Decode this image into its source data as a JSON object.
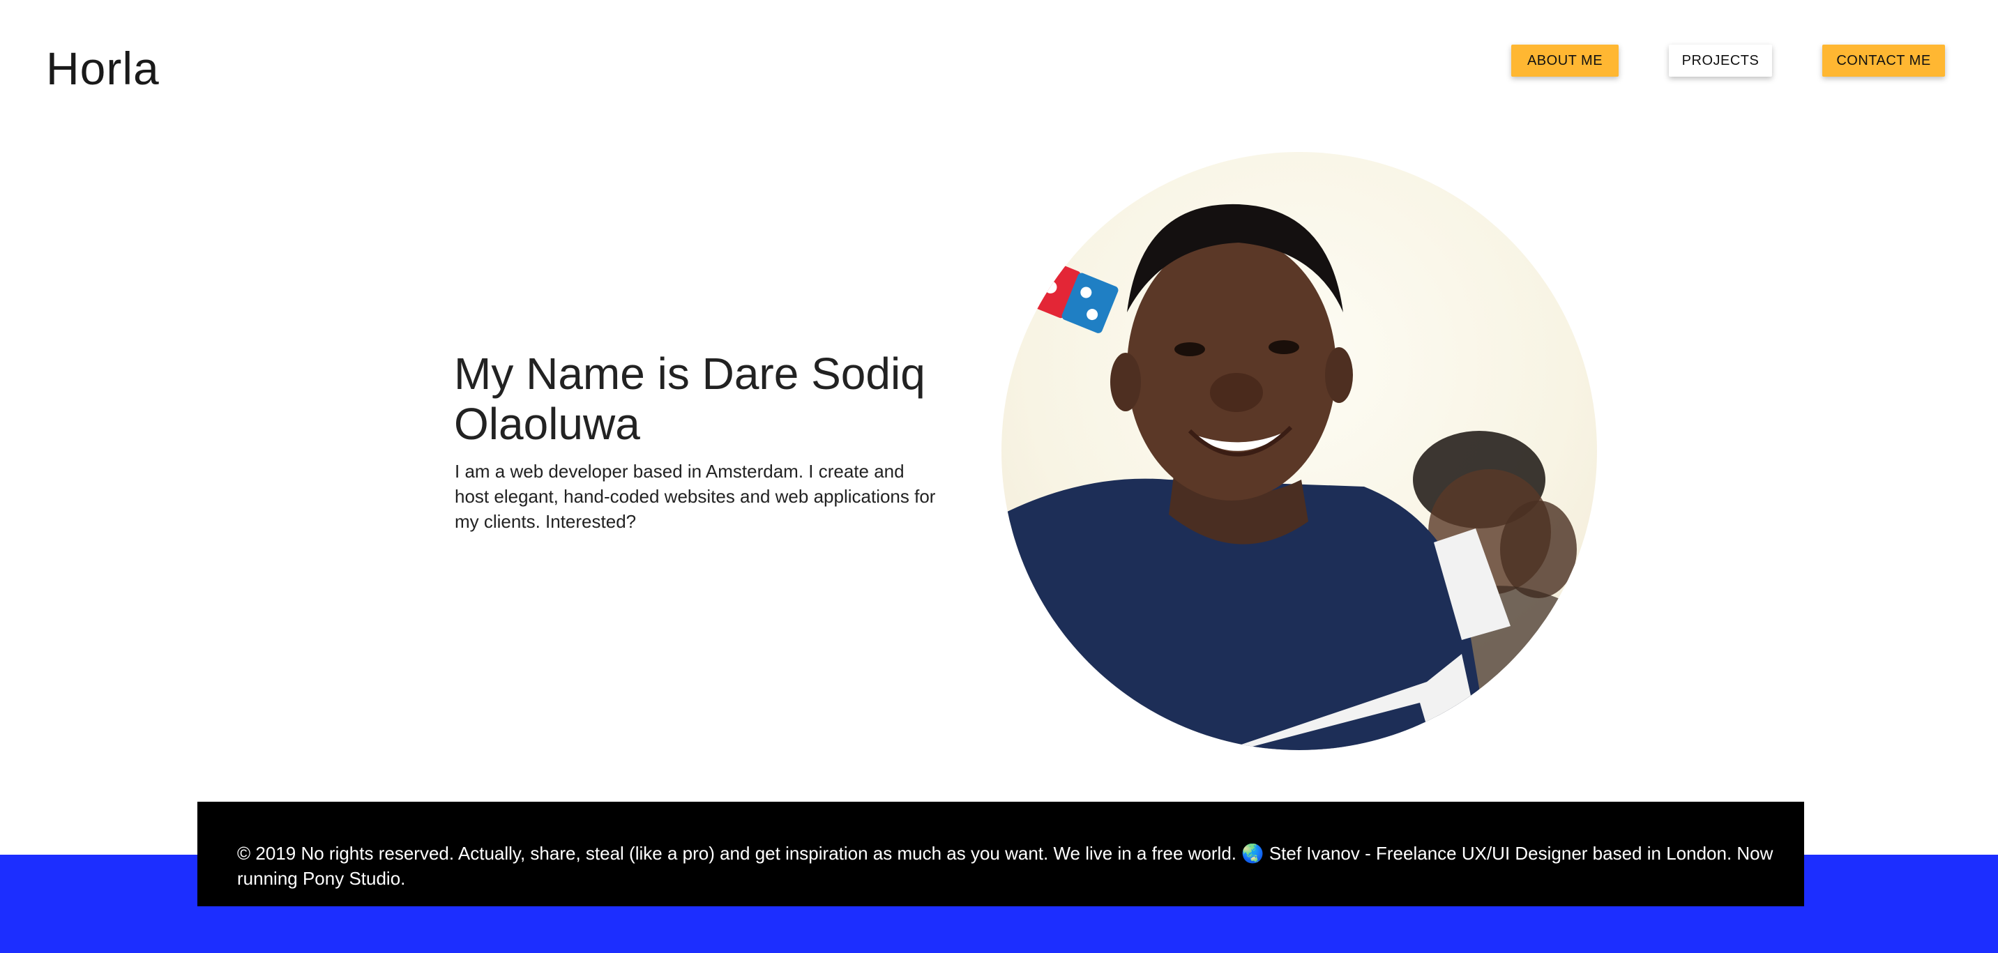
{
  "header": {
    "logo": "Horla",
    "nav": {
      "about_label": "ABOUT ME",
      "projects_label": "PROJECTS",
      "contact_label": "CONTACT ME"
    }
  },
  "hero": {
    "title": "My Name is Dare Sodiq Olaoluwa",
    "description": "I am a web developer based in Amsterdam. I create and host elegant, hand-coded websites and web applications for my clients. Interested?"
  },
  "footer": {
    "text": "© 2019 No rights reserved. Actually, share, steal (like a pro) and get inspiration as much as you want. We live in a free world. 🌏  Stef Ivanov - Freelance UX/UI Designer based in London. Now running Pony Studio."
  },
  "colors": {
    "accent": "#ffb732",
    "footer_bg": "#000000",
    "band": "#1c2eff"
  }
}
